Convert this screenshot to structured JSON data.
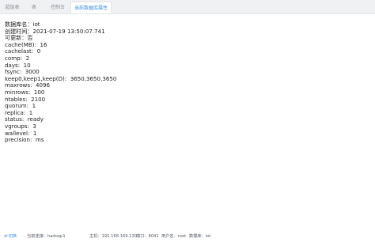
{
  "tabs": [
    {
      "label": "超级表"
    },
    {
      "label": "表"
    },
    {
      "label": "控制台"
    },
    {
      "label": "当前数据库属性",
      "active": true
    }
  ],
  "db_props": [
    {
      "key": "数据库名",
      "sep": "：",
      "value": "iot"
    },
    {
      "key": "创建时间",
      "sep": "：",
      "value": "2021-07-19 13:50:07.741"
    },
    {
      "key": "可更新",
      "sep": "：",
      "value": "否"
    },
    {
      "key": "cache(MB)",
      "sep": ":  ",
      "value": "16"
    },
    {
      "key": "cachelast",
      "sep": ":  ",
      "value": "0"
    },
    {
      "key": "comp",
      "sep": ":  ",
      "value": "2"
    },
    {
      "key": "days",
      "sep": ":  ",
      "value": "10"
    },
    {
      "key": "fsync",
      "sep": ":  ",
      "value": "3000"
    },
    {
      "key": "keep0,keep1,keep(D)",
      "sep": ":  ",
      "value": "3650,3650,3650"
    },
    {
      "key": "maxrows",
      "sep": ":  ",
      "value": "4096"
    },
    {
      "key": "minrows",
      "sep": ":  ",
      "value": "100"
    },
    {
      "key": "ntables",
      "sep": ":  ",
      "value": "2100"
    },
    {
      "key": "quorum",
      "sep": ":  ",
      "value": "1"
    },
    {
      "key": "replica",
      "sep": ":  ",
      "value": "1"
    },
    {
      "key": "status",
      "sep": ":  ",
      "value": "ready"
    },
    {
      "key": "vgroups",
      "sep": ":  ",
      "value": "3"
    },
    {
      "key": "wallevel",
      "sep": ":  ",
      "value": "1"
    },
    {
      "key": "precision",
      "sep": ":  ",
      "value": "ms"
    }
  ],
  "footer": {
    "switch_label": "切换",
    "switch_icon": "swap-icon",
    "conn_label": "当前连接：",
    "conn_value": "hadoop1",
    "host_label": "主机：",
    "host_value": "192.168.169.130",
    "port_label": "端口：",
    "port_value": "6041",
    "user_label": "用户名：",
    "user_value": "root",
    "db_label": "数据库：",
    "db_value": "iot"
  },
  "colors": {
    "accent": "#3a8ee6",
    "tabbar_bg": "#f0f1f3",
    "text": "#222222",
    "muted": "#8a8f99"
  }
}
